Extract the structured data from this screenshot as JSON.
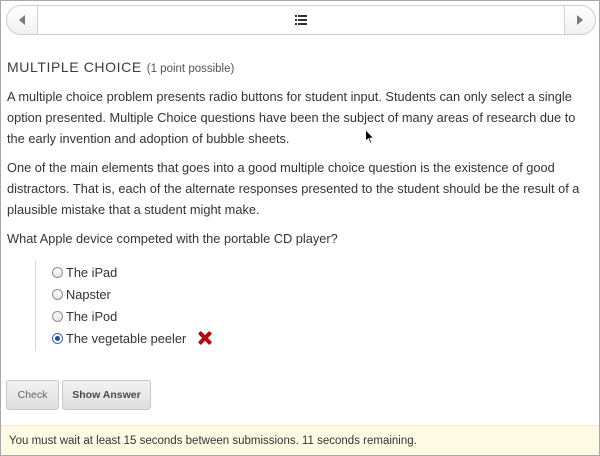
{
  "nav": {
    "prev_icon": "chevron-left-icon",
    "next_icon": "chevron-right-icon",
    "center_icon": "list-icon"
  },
  "problem": {
    "title": "MULTIPLE CHOICE",
    "points": "(1 point possible)",
    "paragraph1": "A multiple choice problem presents radio buttons for student input. Students can only select a single option presented. Multiple Choice questions have been the subject of many areas of research due to the early invention and adoption of bubble sheets.",
    "paragraph2": "One of the main elements that goes into a good multiple choice question is the existence of good distractors. That is, each of the alternate responses presented to the student should be the result of a plausible mistake that a student might make.",
    "question": "What Apple device competed with the portable CD player?",
    "choices": [
      {
        "label": "The iPad",
        "selected": false
      },
      {
        "label": "Napster",
        "selected": false
      },
      {
        "label": "The iPod",
        "selected": false
      },
      {
        "label": "The vegetable peeler",
        "selected": true
      }
    ],
    "result_icon": "incorrect-x-icon",
    "result_color": "#b20610"
  },
  "actions": {
    "check_label": "Check",
    "show_answer_label": "Show Answer"
  },
  "notice": {
    "text": "You must wait at least 15 seconds between submissions. 11 seconds remaining.",
    "background": "#fdfbe3"
  }
}
